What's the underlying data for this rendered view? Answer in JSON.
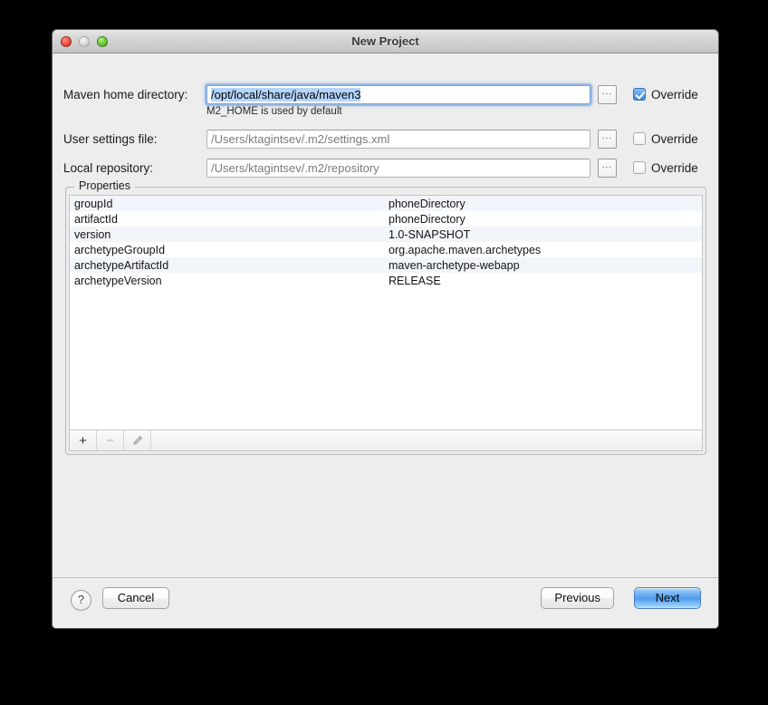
{
  "window": {
    "title": "New Project",
    "traffic_lights": [
      "close-button",
      "minimize-button",
      "zoom-button"
    ]
  },
  "form": {
    "rows": [
      {
        "label": "Maven home directory:",
        "value": "/opt/local/share/java/maven3",
        "selected_text": "/opt/local/share/java/maven3",
        "focused": true,
        "browse_label": "...",
        "override_label": "Override",
        "override_checked": true
      },
      {
        "label": "User settings file:",
        "value": "/Users/ktagintsev/.m2/settings.xml",
        "focused": false,
        "browse_label": "...",
        "override_label": "Override",
        "override_checked": false
      },
      {
        "label": "Local repository:",
        "value": "/Users/ktagintsev/.m2/repository",
        "focused": false,
        "browse_label": "...",
        "override_label": "Override",
        "override_checked": false
      }
    ],
    "hint": "M2_HOME is used by default"
  },
  "properties": {
    "group_title": "Properties",
    "rows": [
      {
        "key": "groupId",
        "value": "phoneDirectory"
      },
      {
        "key": "artifactId",
        "value": "phoneDirectory"
      },
      {
        "key": "version",
        "value": "1.0-SNAPSHOT"
      },
      {
        "key": "archetypeGroupId",
        "value": "org.apache.maven.archetypes"
      },
      {
        "key": "archetypeArtifactId",
        "value": "maven-archetype-webapp"
      },
      {
        "key": "archetypeVersion",
        "value": "RELEASE"
      }
    ],
    "toolbar": {
      "add_label": "+",
      "remove_label": "−",
      "edit_label": "edit-pencil-icon",
      "add_enabled": true,
      "remove_enabled": false,
      "edit_enabled": false
    }
  },
  "footer": {
    "help_label": "?",
    "cancel_label": "Cancel",
    "previous_label": "Previous",
    "next_label": "Next",
    "default_button": "Next"
  },
  "colors": {
    "window_background": "#ededed",
    "accent_blue": "#4f9aec",
    "selection_blue": "#b5d4fb",
    "checkbox_blue": "#3f86e0",
    "row_stripe": "#f2f5fa",
    "desktop": "#000000"
  }
}
